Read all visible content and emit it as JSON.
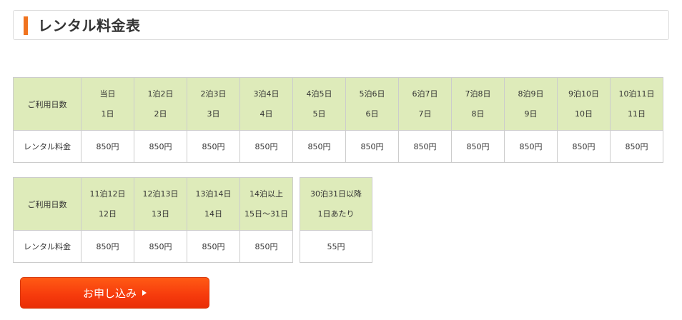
{
  "header": {
    "title": "レンタル料金表"
  },
  "colors": {
    "accent": "#f0731f",
    "header_cell_bg": "#deebba",
    "button_bg": "#f63a0c"
  },
  "table1": {
    "row_label_days": "ご利用日数",
    "row_label_price": "レンタル料金",
    "columns": [
      {
        "plan": "当日",
        "days": "1日",
        "price": "850円"
      },
      {
        "plan": "1泊2日",
        "days": "2日",
        "price": "850円"
      },
      {
        "plan": "2泊3日",
        "days": "3日",
        "price": "850円"
      },
      {
        "plan": "3泊4日",
        "days": "4日",
        "price": "850円"
      },
      {
        "plan": "4泊5日",
        "days": "5日",
        "price": "850円"
      },
      {
        "plan": "5泊6日",
        "days": "6日",
        "price": "850円"
      },
      {
        "plan": "6泊7日",
        "days": "7日",
        "price": "850円"
      },
      {
        "plan": "7泊8日",
        "days": "8日",
        "price": "850円"
      },
      {
        "plan": "8泊9日",
        "days": "9日",
        "price": "850円"
      },
      {
        "plan": "9泊10日",
        "days": "10日",
        "price": "850円"
      },
      {
        "plan": "10泊11日",
        "days": "11日",
        "price": "850円"
      }
    ]
  },
  "table2": {
    "row_label_days": "ご利用日数",
    "row_label_price": "レンタル料金",
    "columns": [
      {
        "plan": "11泊12日",
        "days": "12日",
        "price": "850円"
      },
      {
        "plan": "12泊13日",
        "days": "13日",
        "price": "850円"
      },
      {
        "plan": "13泊14日",
        "days": "14日",
        "price": "850円"
      },
      {
        "plan": "14泊以上",
        "days": "15日〜31日",
        "price": "850円"
      }
    ]
  },
  "table3": {
    "columns": [
      {
        "plan": "30泊31日以降",
        "days": "1日あたり",
        "price": "55円"
      }
    ]
  },
  "apply_button": {
    "label": "お申し込み",
    "icon": "triangle-right-icon"
  }
}
